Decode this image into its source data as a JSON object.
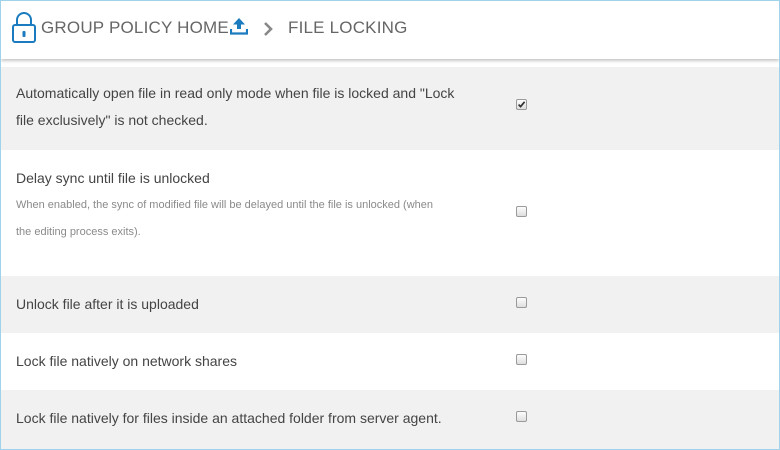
{
  "header": {
    "home_label": "GROUP POLICY HOME",
    "current_label": "FILE LOCKING",
    "lock_icon": "lock-icon",
    "upload_icon": "upload-icon",
    "separator_icon": "chevron-right-icon",
    "accent_color": "#1a7bbf"
  },
  "settings": [
    {
      "line1": "Automatically open file in read only mode when file is locked and \"Lock",
      "line2": "file exclusively\" is not checked.",
      "checked": true
    },
    {
      "label": "Delay sync until file is unlocked",
      "desc_line1": "When enabled, the sync of modified file will be delayed until the file is unlocked (when",
      "desc_line2": "the editing process exits).",
      "checked": false
    },
    {
      "label": "Unlock file after it is uploaded",
      "checked": false
    },
    {
      "label": "Lock file natively on network shares",
      "checked": false
    },
    {
      "label": "Lock file natively for files inside an attached folder from server agent.",
      "checked": false
    }
  ]
}
